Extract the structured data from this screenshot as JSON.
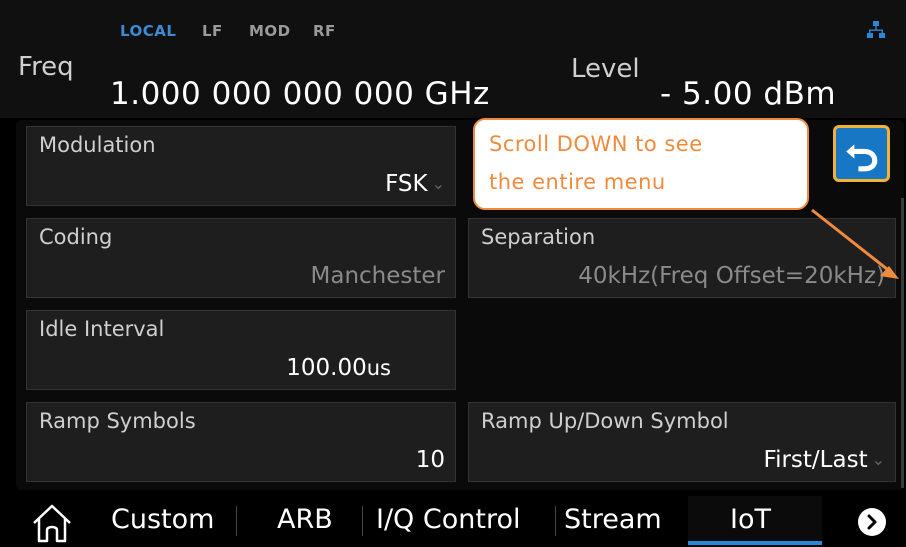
{
  "status_indicators": [
    "LOCAL",
    "LF",
    "MOD",
    "RF"
  ],
  "network_icon": "network-icon",
  "freq": {
    "label": "Freq",
    "value": "1.000 000 000 000  GHz"
  },
  "level": {
    "label": "Level",
    "value": "- 5.00  dBm"
  },
  "fields": {
    "modulation": {
      "label": "Modulation",
      "value": "FSK"
    },
    "coding": {
      "label": "Coding",
      "value": "Manchester"
    },
    "separation": {
      "label": "Separation",
      "value": "40kHz(Freq Offset=20kHz)"
    },
    "idle_interval": {
      "label": "Idle Interval",
      "value": "100.00",
      "unit": "us"
    },
    "ramp_symbols": {
      "label": "Ramp Symbols",
      "value": "10"
    },
    "ramp_updown": {
      "label": "Ramp Up/Down Symbol",
      "value": "First/Last"
    }
  },
  "callout": {
    "line1": "Scroll DOWN to see",
    "line2": "the entire menu"
  },
  "tabs": [
    "Custom",
    "ARB",
    "I/Q Control",
    "Stream",
    "IoT"
  ],
  "active_tab": "IoT",
  "colors": {
    "accent_blue": "#2a86d6",
    "callout_orange": "#f08a3c",
    "back_border": "#f2b233"
  }
}
